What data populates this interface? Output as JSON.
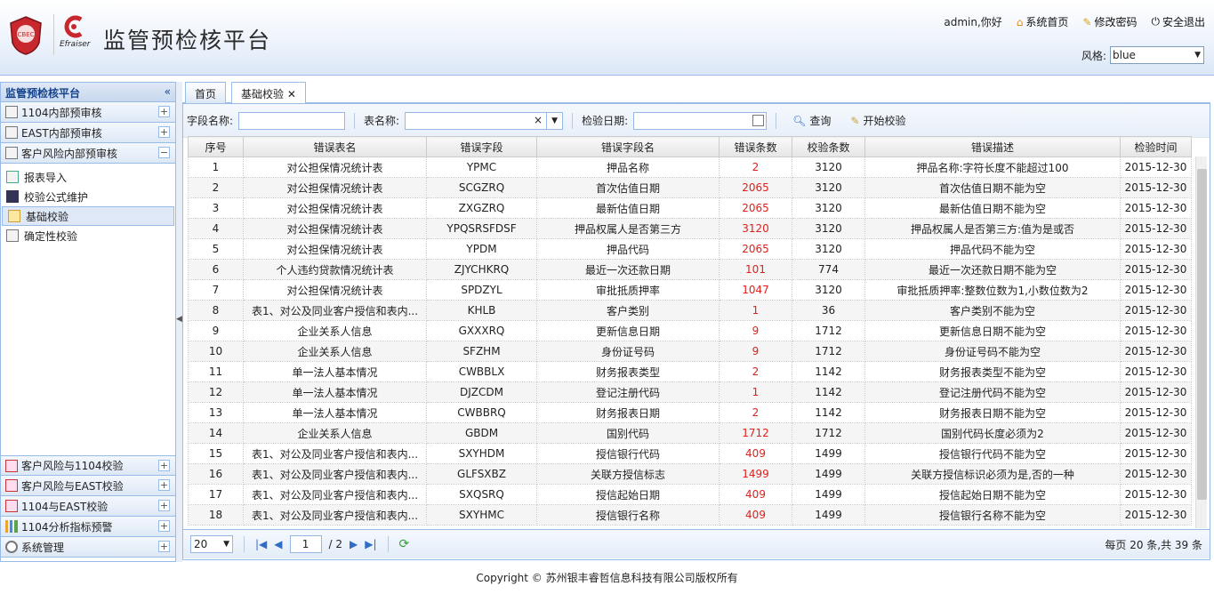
{
  "app": {
    "title": "监管预检核平台",
    "logo_text": "CBEC",
    "logo2_text": "Efraiser"
  },
  "toplinks": {
    "greeting": "admin,你好",
    "home": "系统首页",
    "password": "修改密码",
    "logout": "安全退出"
  },
  "style": {
    "label": "风格:",
    "value": "blue"
  },
  "sidebar": {
    "title": "监管预检核平台",
    "groups_top": [
      {
        "label": "1104内部预审核",
        "state": "+"
      },
      {
        "label": "EAST内部预审核",
        "state": "+"
      },
      {
        "label": "客户风险内部预审核",
        "state": "−"
      }
    ],
    "items": [
      {
        "label": "报表导入",
        "icon": "import-icon"
      },
      {
        "label": "校验公式维护",
        "icon": "formula-icon"
      },
      {
        "label": "基础校验",
        "icon": "check-icon",
        "selected": true
      },
      {
        "label": "确定性校验",
        "icon": "confirm-icon"
      }
    ],
    "groups_bottom": [
      {
        "label": "客户风险与1104校验",
        "state": "+"
      },
      {
        "label": "客户风险与EAST校验",
        "state": "+"
      },
      {
        "label": "1104与EAST校验",
        "state": "+"
      },
      {
        "label": "1104分析指标预警",
        "state": "+"
      },
      {
        "label": "系统管理",
        "state": "+"
      }
    ]
  },
  "tabs": [
    {
      "label": "首页"
    },
    {
      "label": "基础校验"
    }
  ],
  "toolbar": {
    "field_label": "字段名称:",
    "table_label": "表名称:",
    "date_label": "检验日期:",
    "query": "查询",
    "start": "开始校验"
  },
  "grid": {
    "columns": [
      "序号",
      "错误表名",
      "错误字段",
      "错误字段名",
      "错误条数",
      "校验条数",
      "错误描述",
      "检验时间"
    ],
    "rows": [
      [
        "1",
        "对公担保情况统计表",
        "YPMC",
        "押品名称",
        "2",
        "3120",
        "押品名称:字符长度不能超过100",
        "2015-12-30"
      ],
      [
        "2",
        "对公担保情况统计表",
        "SCGZRQ",
        "首次估值日期",
        "2065",
        "3120",
        "首次估值日期不能为空",
        "2015-12-30"
      ],
      [
        "3",
        "对公担保情况统计表",
        "ZXGZRQ",
        "最新估值日期",
        "2065",
        "3120",
        "最新估值日期不能为空",
        "2015-12-30"
      ],
      [
        "4",
        "对公担保情况统计表",
        "YPQSRSFDSF",
        "押品权属人是否第三方",
        "3120",
        "3120",
        "押品权属人是否第三方:值为是或否",
        "2015-12-30"
      ],
      [
        "5",
        "对公担保情况统计表",
        "YPDM",
        "押品代码",
        "2065",
        "3120",
        "押品代码不能为空",
        "2015-12-30"
      ],
      [
        "6",
        "个人违约贷款情况统计表",
        "ZJYCHKRQ",
        "最近一次还款日期",
        "101",
        "774",
        "最近一次还款日期不能为空",
        "2015-12-30"
      ],
      [
        "7",
        "对公担保情况统计表",
        "SPDZYL",
        "审批抵质押率",
        "1047",
        "3120",
        "审批抵质押率:整数位数为1,小数位数为2",
        "2015-12-30"
      ],
      [
        "8",
        "表1、对公及同业客户授信和表内...",
        "KHLB",
        "客户类别",
        "1",
        "36",
        "客户类别不能为空",
        "2015-12-30"
      ],
      [
        "9",
        "企业关系人信息",
        "GXXXRQ",
        "更新信息日期",
        "9",
        "1712",
        "更新信息日期不能为空",
        "2015-12-30"
      ],
      [
        "10",
        "企业关系人信息",
        "SFZHM",
        "身份证号码",
        "9",
        "1712",
        "身份证号码不能为空",
        "2015-12-30"
      ],
      [
        "11",
        "单一法人基本情况",
        "CWBBLX",
        "财务报表类型",
        "2",
        "1142",
        "财务报表类型不能为空",
        "2015-12-30"
      ],
      [
        "12",
        "单一法人基本情况",
        "DJZCDM",
        "登记注册代码",
        "1",
        "1142",
        "登记注册代码不能为空",
        "2015-12-30"
      ],
      [
        "13",
        "单一法人基本情况",
        "CWBBRQ",
        "财务报表日期",
        "2",
        "1142",
        "财务报表日期不能为空",
        "2015-12-30"
      ],
      [
        "14",
        "企业关系人信息",
        "GBDM",
        "国别代码",
        "1712",
        "1712",
        "国别代码长度必须为2",
        "2015-12-30"
      ],
      [
        "15",
        "表1、对公及同业客户授信和表内...",
        "SXYHDM",
        "授信银行代码",
        "409",
        "1499",
        "授信银行代码不能为空",
        "2015-12-30"
      ],
      [
        "16",
        "表1、对公及同业客户授信和表内...",
        "GLFSXBZ",
        "关联方授信标志",
        "1499",
        "1499",
        "关联方授信标识必须为是,否的一种",
        "2015-12-30"
      ],
      [
        "17",
        "表1、对公及同业客户授信和表内...",
        "SXQSRQ",
        "授信起始日期",
        "409",
        "1499",
        "授信起始日期不能为空",
        "2015-12-30"
      ],
      [
        "18",
        "表1、对公及同业客户授信和表内...",
        "SXYHMC",
        "授信银行名称",
        "409",
        "1499",
        "授信银行名称不能为空",
        "2015-12-30"
      ]
    ]
  },
  "pager": {
    "page_size": "20",
    "page": "1",
    "total_pages": "/ 2",
    "summary": "每页 20 条,共 39 条"
  },
  "footer": "Copyright © 苏州银丰睿哲信息科技有限公司版权所有"
}
